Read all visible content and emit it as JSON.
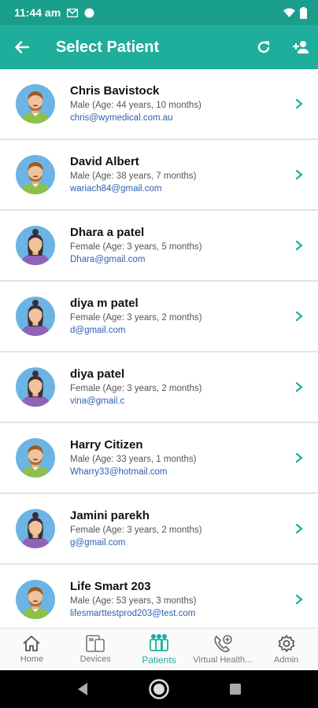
{
  "status_bar": {
    "time": "11:44 am"
  },
  "app_bar": {
    "title": "Select Patient",
    "background": "#1fae9c"
  },
  "patients": [
    {
      "name": "Chris Bavistock",
      "meta": "Male (Age: 44 years, 10 months)",
      "email": "chris@wymedical.com.au",
      "avatar": "male"
    },
    {
      "name": "David Albert",
      "meta": "Male (Age: 38 years, 7 months)",
      "email": "wariach84@gmail.com",
      "avatar": "male"
    },
    {
      "name": "Dhara a patel",
      "meta": "Female (Age: 3 years, 5 months)",
      "email": "Dhara@gmail.com",
      "avatar": "female"
    },
    {
      "name": "diya m patel",
      "meta": "Female (Age: 3 years, 2 months)",
      "email": "d@gmail.com",
      "avatar": "female"
    },
    {
      "name": "diya patel",
      "meta": "Female (Age: 3 years, 2 months)",
      "email": "vina@gmail.c",
      "avatar": "female"
    },
    {
      "name": "Harry Citizen",
      "meta": "Male (Age: 33 years, 1 months)",
      "email": "Wharry33@hotmail.com",
      "avatar": "male"
    },
    {
      "name": "Jamini parekh",
      "meta": "Female (Age: 3 years, 2 months)",
      "email": "g@gmail.com",
      "avatar": "female"
    },
    {
      "name": "Life Smart 203",
      "meta": "Male (Age: 53 years, 3 months)",
      "email": "lifesmarttestprod203@test.com",
      "avatar": "male"
    }
  ],
  "bottom_nav": {
    "items": [
      {
        "label": "Home",
        "icon": "home-icon",
        "active": false
      },
      {
        "label": "Devices",
        "icon": "devices-icon",
        "active": false
      },
      {
        "label": "Patients",
        "icon": "patients-icon",
        "active": true
      },
      {
        "label": "Virtual Health...",
        "icon": "virtual-health-icon",
        "active": false
      },
      {
        "label": "Admin",
        "icon": "gear-icon",
        "active": false
      }
    ]
  },
  "colors": {
    "primary": "#1fae9c",
    "status_bar": "#1a9e8c",
    "email": "#2f5fb0"
  }
}
